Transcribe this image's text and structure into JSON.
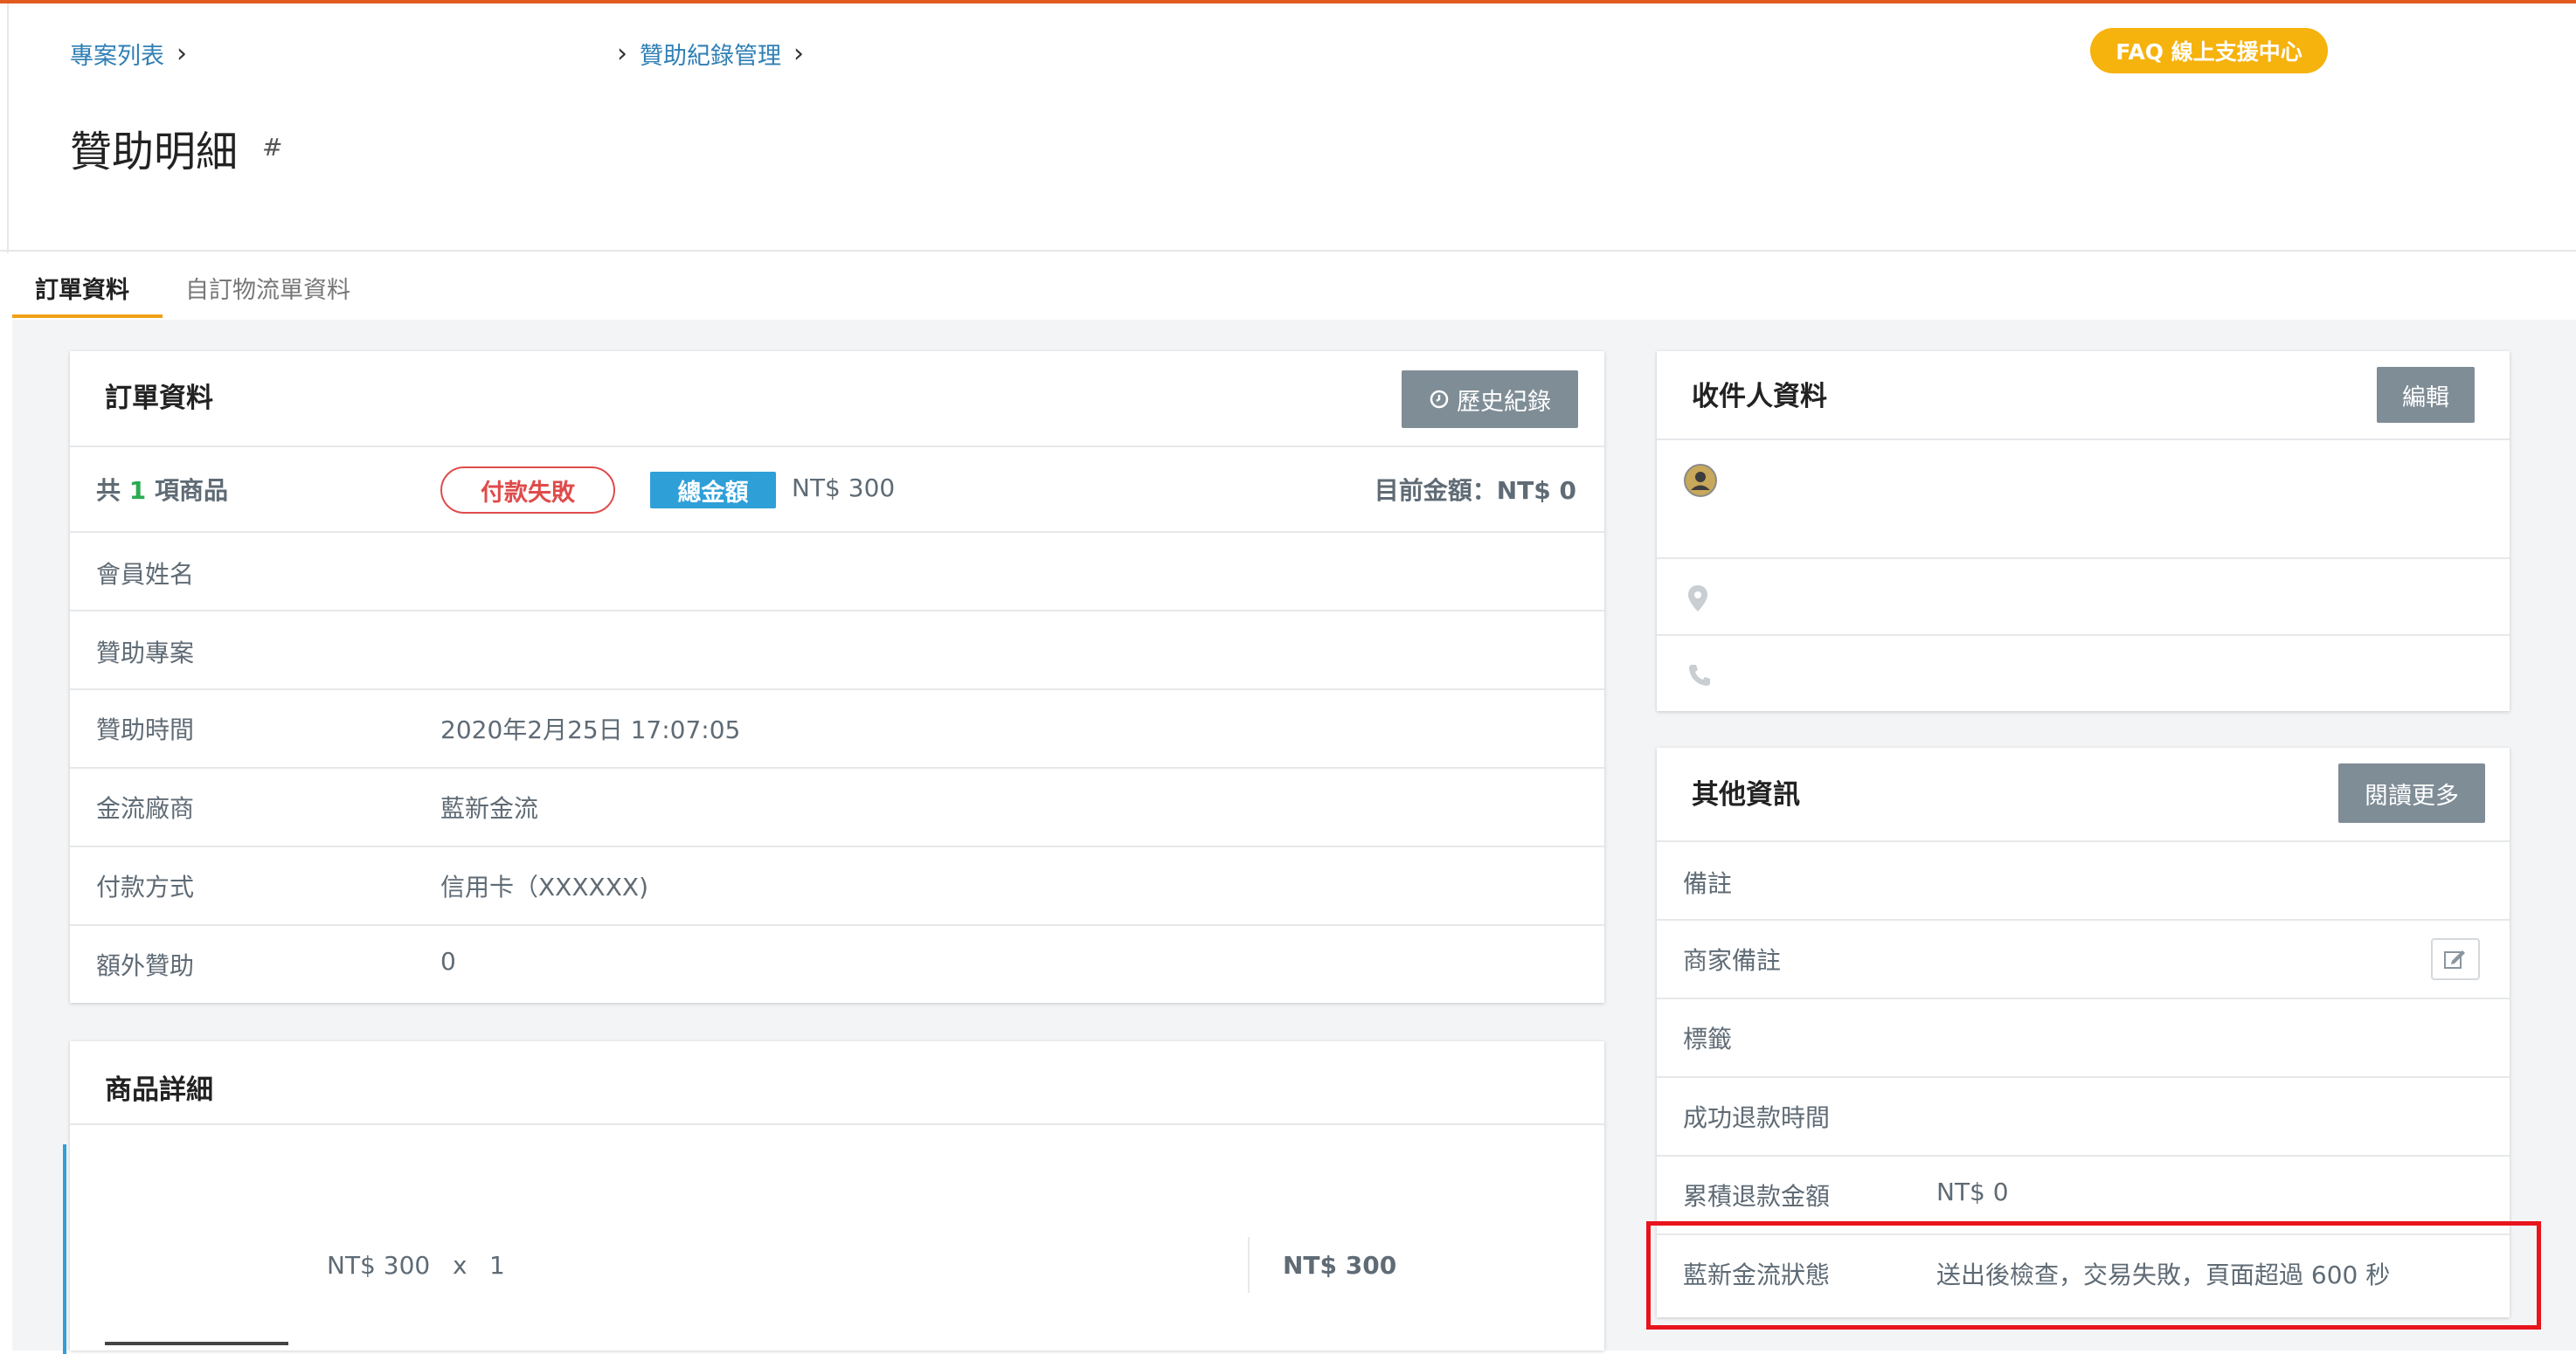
{
  "breadcrumb": {
    "item1": "專案列表",
    "item2": "贊助紀錄管理"
  },
  "faq_label": "FAQ 線上支援中心",
  "page": {
    "title": "贊助明細",
    "hash": "#"
  },
  "tabs": [
    {
      "label": "訂單資料",
      "active": true
    },
    {
      "label": "自訂物流單資料",
      "active": false
    }
  ],
  "order_card": {
    "title": "訂單資料",
    "history_button": "歷史紀錄",
    "summary": {
      "count_prefix": "共",
      "count": "1",
      "count_suffix": "項商品",
      "status_badge": "付款失敗",
      "total_badge": "總金額",
      "total_amount": "NT$ 300",
      "current_amount": "目前金額：NT$ 0"
    },
    "rows": [
      {
        "label": "會員姓名",
        "value": ""
      },
      {
        "label": "贊助專案",
        "value": ""
      },
      {
        "label": "贊助時間",
        "value": "2020年2月25日 17:07:05"
      },
      {
        "label": "金流廠商",
        "value": "藍新金流"
      },
      {
        "label": "付款方式",
        "value": "信用卡（XXXXXX)"
      },
      {
        "label": "額外贊助",
        "value": "0"
      }
    ]
  },
  "product_card": {
    "title": "商品詳細",
    "unit_price": "NT$ 300",
    "times": "x",
    "qty": "1",
    "subtotal": "NT$ 300"
  },
  "recipient_card": {
    "title": "收件人資料",
    "edit_button": "編輯"
  },
  "other_card": {
    "title": "其他資訊",
    "more_button": "閱讀更多",
    "rows": [
      {
        "label": "備註",
        "value": ""
      },
      {
        "label": "商家備註",
        "value": ""
      },
      {
        "label": "標籤",
        "value": ""
      },
      {
        "label": "成功退款時間",
        "value": ""
      },
      {
        "label": "累積退款金額",
        "value": "NT$ 0"
      },
      {
        "label": "藍新金流狀態",
        "value": "送出後檢查，交易失敗，頁面超過 600 秒"
      }
    ]
  },
  "colors": {
    "accent_orange": "#e35a1e",
    "faq_yellow": "#f6b20d",
    "link_blue": "#2f7fb5",
    "fail_red": "#e04b4b",
    "badge_blue": "#2f9fd8",
    "highlight_red": "#e8141c"
  }
}
